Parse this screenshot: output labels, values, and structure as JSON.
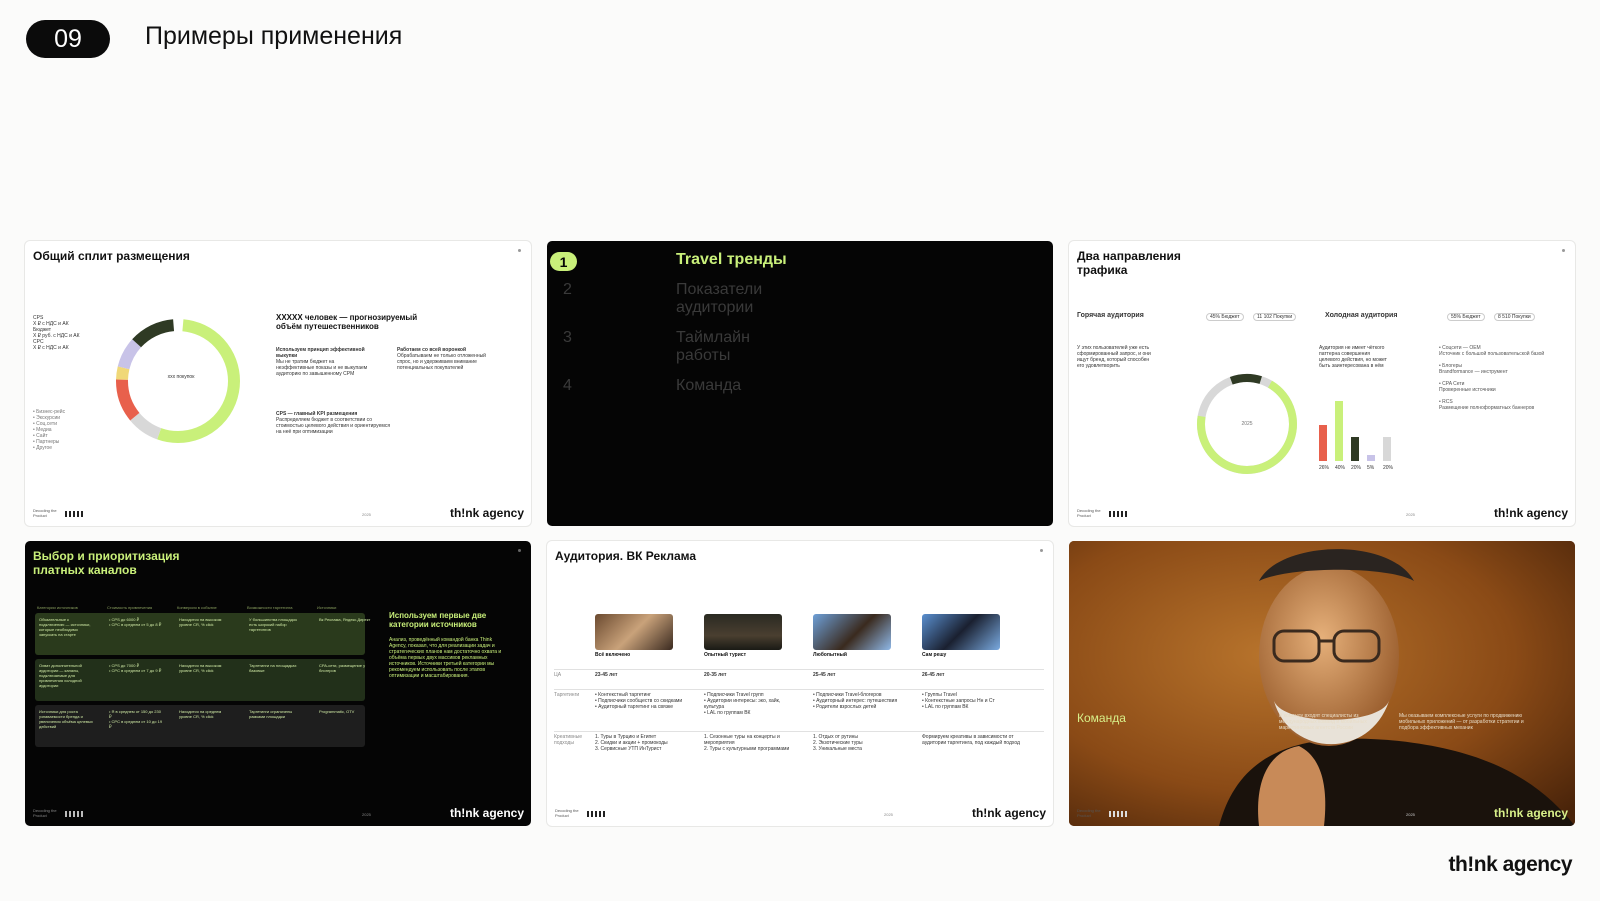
{
  "header": {
    "section_number": "09",
    "title": "Примеры применения"
  },
  "brand": "th!nk agency",
  "slides": [
    {
      "title": "Общий сплит размещения",
      "headline": "XXXXX человек — прогнозируемый объём путешественников",
      "donut_center": "xxx покупок",
      "notes": [
        "Используем принцип эффективной выкупки",
        "Работаем со всей воронкой",
        "CPS — главный KPI размещения"
      ],
      "footer_left": "Decoding the Product",
      "year": "2025",
      "brand": "th!nk agency"
    },
    {
      "agenda": [
        {
          "num": "1",
          "label": "Travel тренды",
          "active": true
        },
        {
          "num": "2",
          "label": "Показатели аудитории",
          "active": false
        },
        {
          "num": "3",
          "label": "Таймлайн работы",
          "active": false
        },
        {
          "num": "4",
          "label": "Команда",
          "active": false
        }
      ]
    },
    {
      "title": "Два направления трафика",
      "hot": {
        "label": "Горячая аудитория",
        "budget": "45% Бюджет",
        "purchases": "11 102 Покупки"
      },
      "cold": {
        "label": "Холодная аудитория",
        "budget": "55% Бюджет",
        "purchases": "8 510 Покупки"
      },
      "donut_center": "2025",
      "bar_values": [
        24,
        40,
        16,
        4,
        16
      ],
      "bar_labels": [
        "26%",
        "40%",
        "20%",
        "5%",
        "20%"
      ],
      "footer_left": "Decoding the Product",
      "year": "2025",
      "brand": "th!nk agency"
    },
    {
      "title": "Выбор и приоритизация платных каналов",
      "side_title": "Используем первые две категории источников",
      "footer_left": "Decoding the Product",
      "year": "2025",
      "brand": "th!nk agency"
    },
    {
      "title": "Аудитория. ВК Реклама",
      "personas": [
        "Всё включено",
        "Опытный турист",
        "Любопытный",
        "Сам решу"
      ],
      "ages": [
        "23-45 лет",
        "20-35 лет",
        "25-45 лет",
        "26-45 лет"
      ],
      "footer_left": "Decoding the Product",
      "year": "2025",
      "brand": "th!nk agency"
    },
    {
      "title": "Команда",
      "footer_left": "Decoding the Product",
      "year": "2025",
      "brand": "th!nk agency"
    }
  ],
  "colors": {
    "accent": "#c9f07a",
    "dark": "#050505",
    "red": "#e8604c",
    "lavender": "#c8c3e8"
  }
}
